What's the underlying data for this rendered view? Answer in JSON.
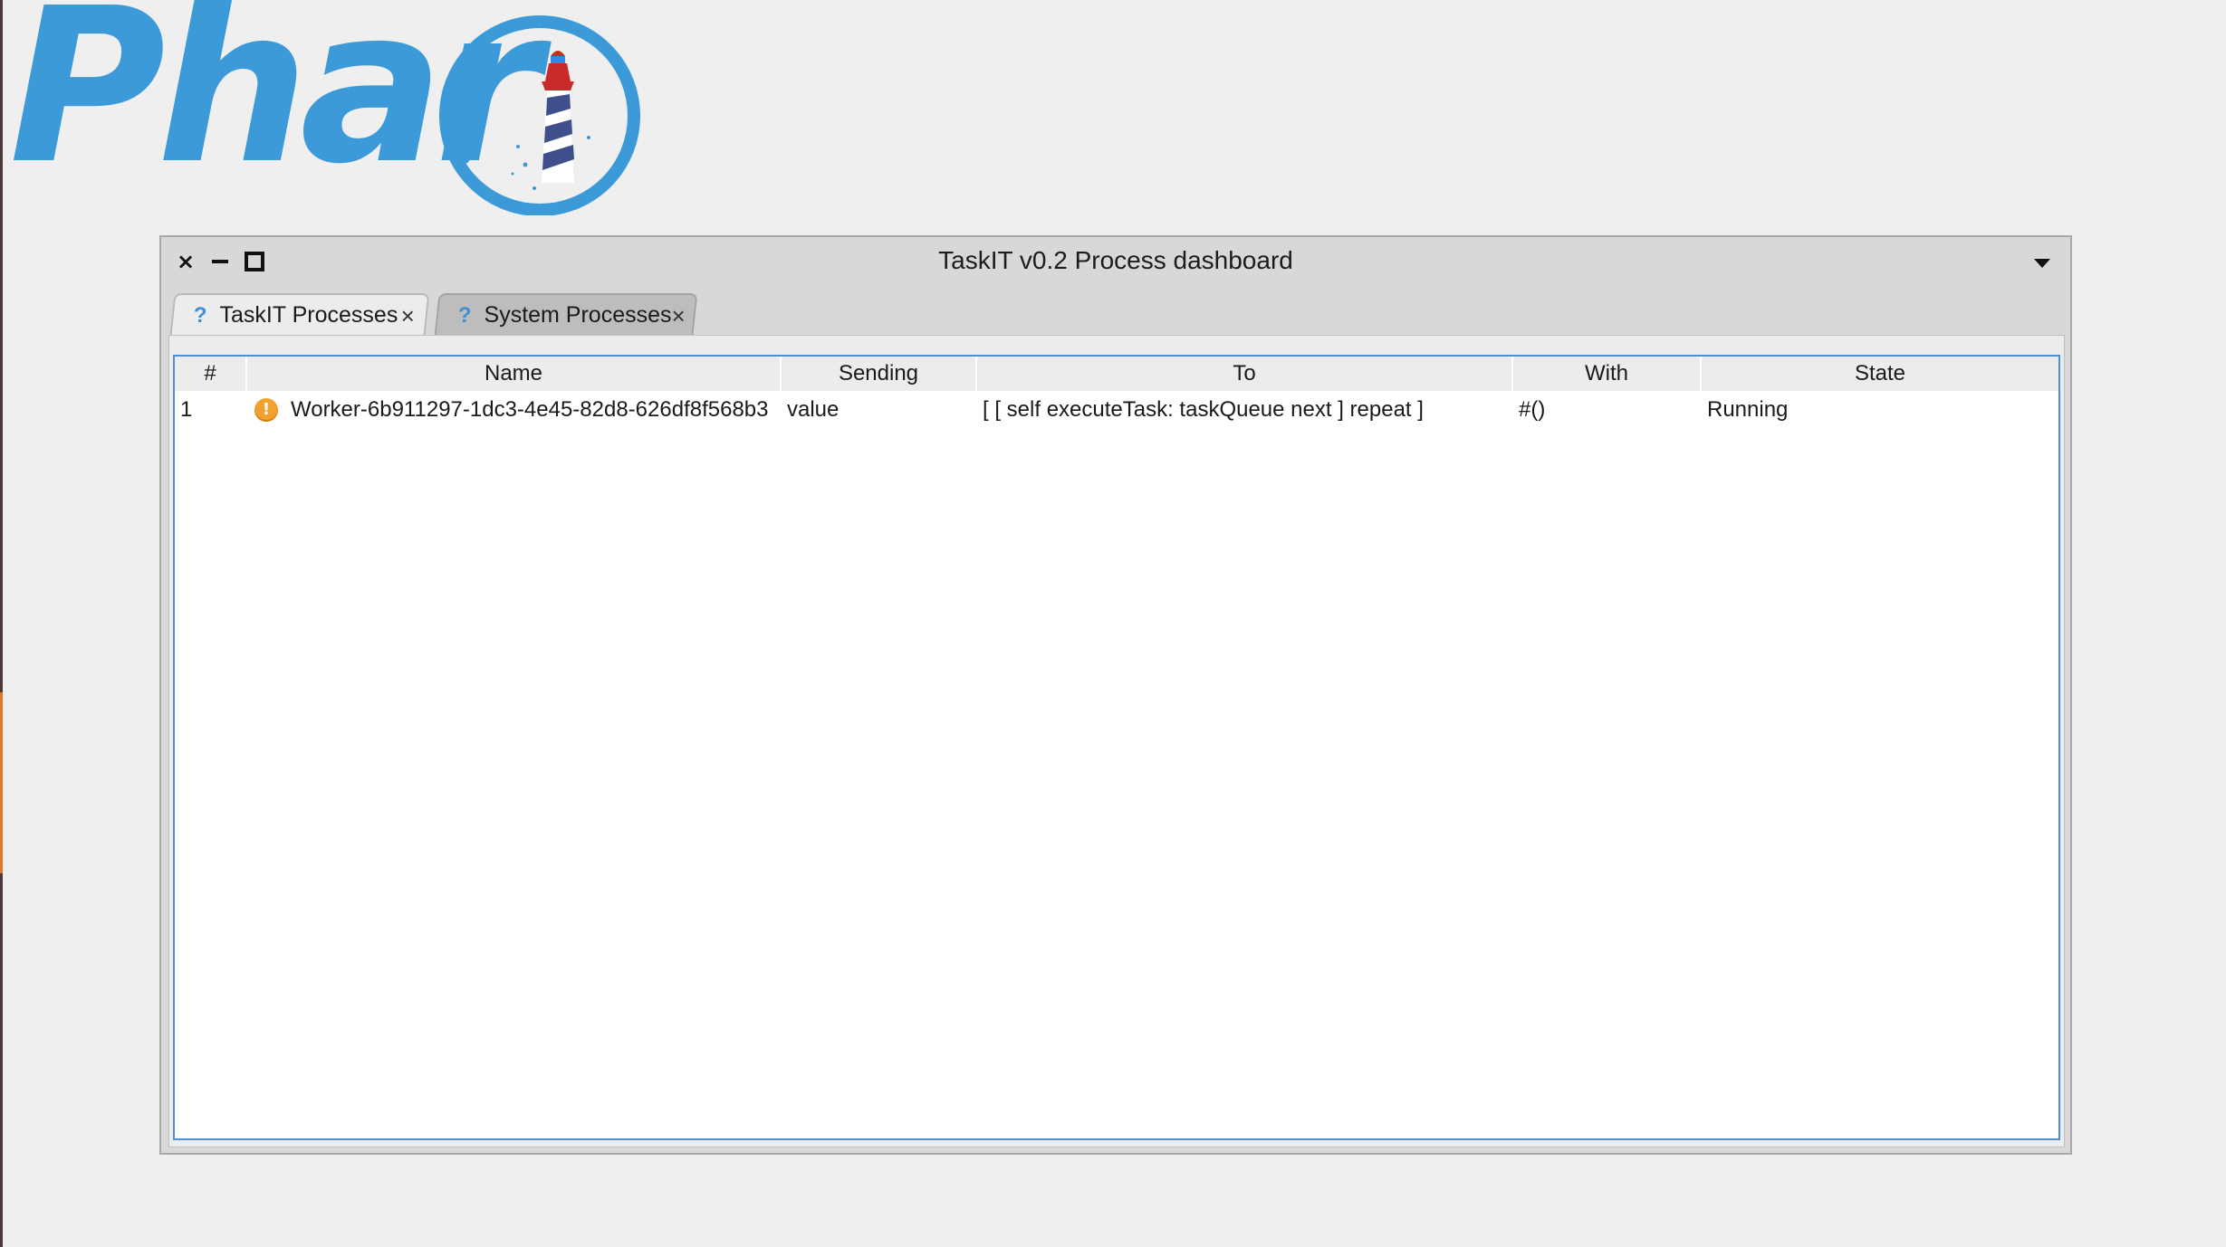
{
  "logo": {
    "text": "Phar",
    "brand_color": "#3c9ad8",
    "icon": "lighthouse-icon"
  },
  "window": {
    "title": "TaskIT v0.2 Process dashboard",
    "close_glyph": "×",
    "tabs": [
      {
        "label": "TaskIT Processes",
        "icon_glyph": "?",
        "close_glyph": "×",
        "active": true
      },
      {
        "label": "System Processes",
        "icon_glyph": "?",
        "close_glyph": "×",
        "active": false
      }
    ]
  },
  "table": {
    "columns": [
      "#",
      "Name",
      "Sending",
      "To",
      "With",
      "State"
    ],
    "rows": [
      {
        "num": "1",
        "status_icon": "warning-icon",
        "status_glyph": "!",
        "name": "Worker-6b911297-1dc3-4e45-82d8-626df8f568b3",
        "sending": "value",
        "to": "[ [ self executeTask: taskQueue next ] repeat ]",
        "with": "#()",
        "state": "Running"
      }
    ]
  },
  "colors": {
    "accent": "#4b8fd6",
    "warning": "#f2a12e",
    "desktop": "#efefef"
  }
}
